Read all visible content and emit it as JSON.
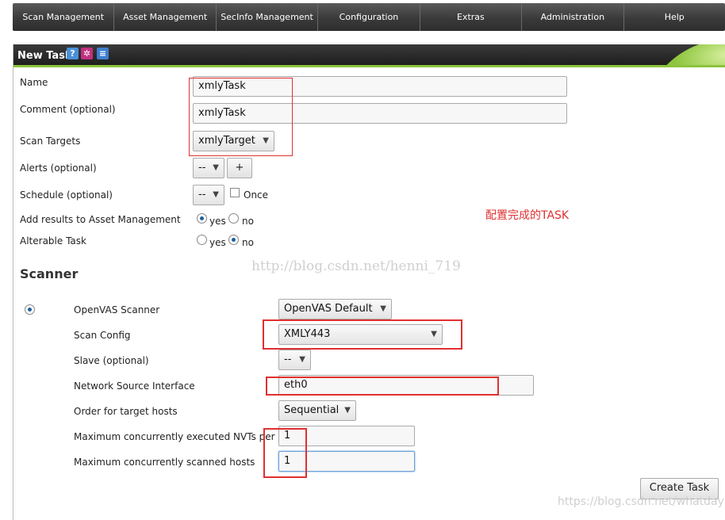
{
  "nav": {
    "items": [
      "Scan Management",
      "Asset Management",
      "SecInfo Management",
      "Configuration",
      "Extras",
      "Administration",
      "Help"
    ]
  },
  "panel": {
    "title": "New Task",
    "icons": [
      "help-icon",
      "wizard-icon",
      "list-icon"
    ]
  },
  "form": {
    "name_label": "Name",
    "name_value": "xmlyTask",
    "comment_label": "Comment (optional)",
    "comment_value": "xmlyTask",
    "targets_label": "Scan Targets",
    "targets_value": "xmlyTarget",
    "alerts_label": "Alerts (optional)",
    "alerts_value": "--",
    "alerts_add": "+",
    "schedule_label": "Schedule (optional)",
    "schedule_value": "--",
    "schedule_once": "Once",
    "add_results_label": "Add results to Asset Management",
    "add_results_yes": "yes",
    "add_results_no": "no",
    "alterable_label": "Alterable Task",
    "alterable_yes": "yes",
    "alterable_no": "no"
  },
  "scanner": {
    "title": "Scanner",
    "openvas_label": "OpenVAS Scanner",
    "openvas_value": "OpenVAS Default",
    "config_label": "Scan Config",
    "config_value": "XMLY443",
    "slave_label": "Slave (optional)",
    "slave_value": "--",
    "iface_label": "Network Source Interface",
    "iface_value": "eth0",
    "order_label": "Order for target hosts",
    "order_value": "Sequential",
    "max_nvts_label": "Maximum concurrently executed NVTs per host",
    "max_nvts_value": "1",
    "max_hosts_label": "Maximum concurrently scanned hosts",
    "max_hosts_value": "1"
  },
  "actions": {
    "create": "Create Task"
  },
  "annotation": "配置完成的TASK",
  "watermarks": [
    "http://blog.csdn.net/henni_719",
    "https://blog.csdn.net/whatday"
  ]
}
